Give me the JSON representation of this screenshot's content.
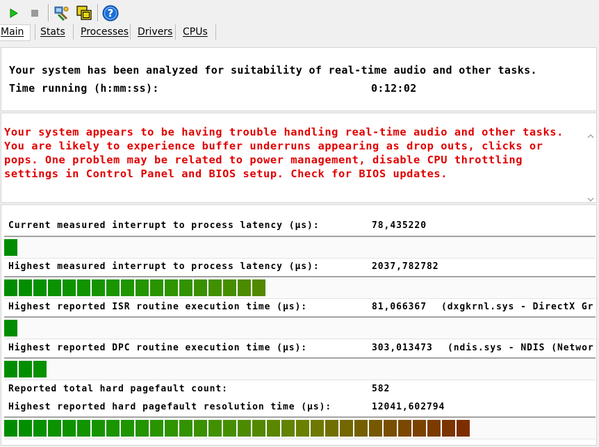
{
  "toolbar": {
    "icons": [
      "play-icon",
      "stop-icon",
      "network-adapter-icon",
      "windows-icon",
      "help-icon"
    ]
  },
  "tabs": [
    {
      "label": "Main",
      "active": true
    },
    {
      "label": "Stats"
    },
    {
      "label": "Processes"
    },
    {
      "label": "Drivers"
    },
    {
      "label": "CPUs"
    }
  ],
  "summary": {
    "analyzed_text": "Your system has been analyzed for suitability of real-time audio and other tasks.",
    "time_label": "Time running (h:mm:ss):",
    "time_value": "0:12:02"
  },
  "warning": {
    "lines": [
      "Your system appears to be having trouble handling real-time audio and other tasks.",
      "You are likely to experience buffer underruns appearing as drop outs, clicks or",
      "pops. One problem may be related to power management, disable CPU throttling",
      "settings in Control Panel and BIOS setup. Check for BIOS updates."
    ],
    "color": "#e00000"
  },
  "metrics": {
    "current_latency": {
      "label": "Current measured interrupt to process latency (µs):",
      "value": "78,435220",
      "level": 0.022
    },
    "highest_latency": {
      "label": "Highest measured interrupt to process latency (µs):",
      "value": "2037,782782",
      "level": 0.44
    },
    "isr": {
      "label": "Highest reported ISR routine execution time (µs):",
      "value": "81,066367",
      "detail": "(dxgkrnl.sys - DirectX Gr",
      "level": 0.022
    },
    "dpc": {
      "label": "Highest reported DPC routine execution time (µs):",
      "value": "303,013473",
      "detail": "(ndis.sys - NDIS (Networ",
      "level": 0.075
    },
    "pagefault_count": {
      "label": "Reported total hard pagefault count:",
      "value": "582"
    },
    "pagefault_time": {
      "label": "Highest reported hard pagefault resolution time (µs):",
      "value": "12041,602794",
      "level": 0.8
    }
  },
  "colors": {
    "bar_start": "#00ff00",
    "bar_end": "#d60000",
    "help_blue": "#1c6fd6"
  }
}
